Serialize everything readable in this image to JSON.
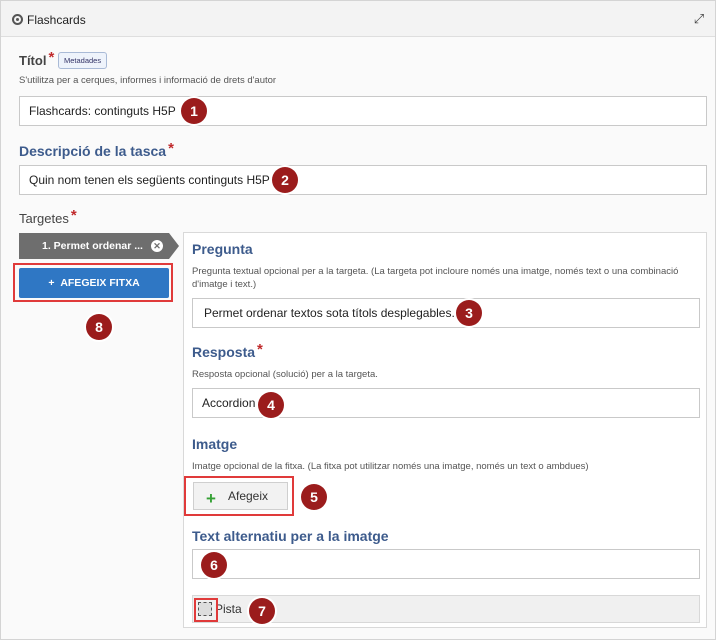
{
  "window": {
    "title": "Flashcards"
  },
  "title_field": {
    "label": "Títol",
    "required": "*",
    "badge": "Metadades",
    "description": "S'utilitza per a cerques, informes i informació de drets d'autor",
    "value": "Flashcards: continguts H5P"
  },
  "task_description": {
    "label": "Descripció de la tasca",
    "required": "*",
    "value": "Quin nom tenen els següents continguts H5P"
  },
  "cards": {
    "label": "Targetes",
    "required": "*",
    "items": [
      {
        "label": "1. Permet ordenar ..."
      }
    ],
    "add_button": "AFEGEIX FITXA",
    "add_button_icon": "plus-icon"
  },
  "question": {
    "label": "Pregunta",
    "description": "Pregunta textual opcional per a la targeta. (La targeta pot incloure només una imatge, només text o una combinació d'imatge i text.)",
    "value": "Permet ordenar textos sota títols desplegables."
  },
  "answer": {
    "label": "Resposta",
    "required": "*",
    "description": "Resposta opcional (solució) per a la targeta.",
    "value": "Accordion"
  },
  "image": {
    "label": "Imatge",
    "description": "Imatge opcional de la fitxa. (La fitxa pot utilitzar només una imatge, només un text o ambdues)",
    "add_button": "Afegeix"
  },
  "alt_text": {
    "label": "Text alternatiu per a la imatge",
    "value": ""
  },
  "hint": {
    "label": "Pista"
  },
  "markers": [
    "1",
    "2",
    "3",
    "4",
    "5",
    "6",
    "7",
    "8"
  ],
  "colors": {
    "accent": "#2f77c4",
    "marker": "#9b1c1c",
    "highlight": "#e03a3a",
    "required": "#c0292b"
  }
}
